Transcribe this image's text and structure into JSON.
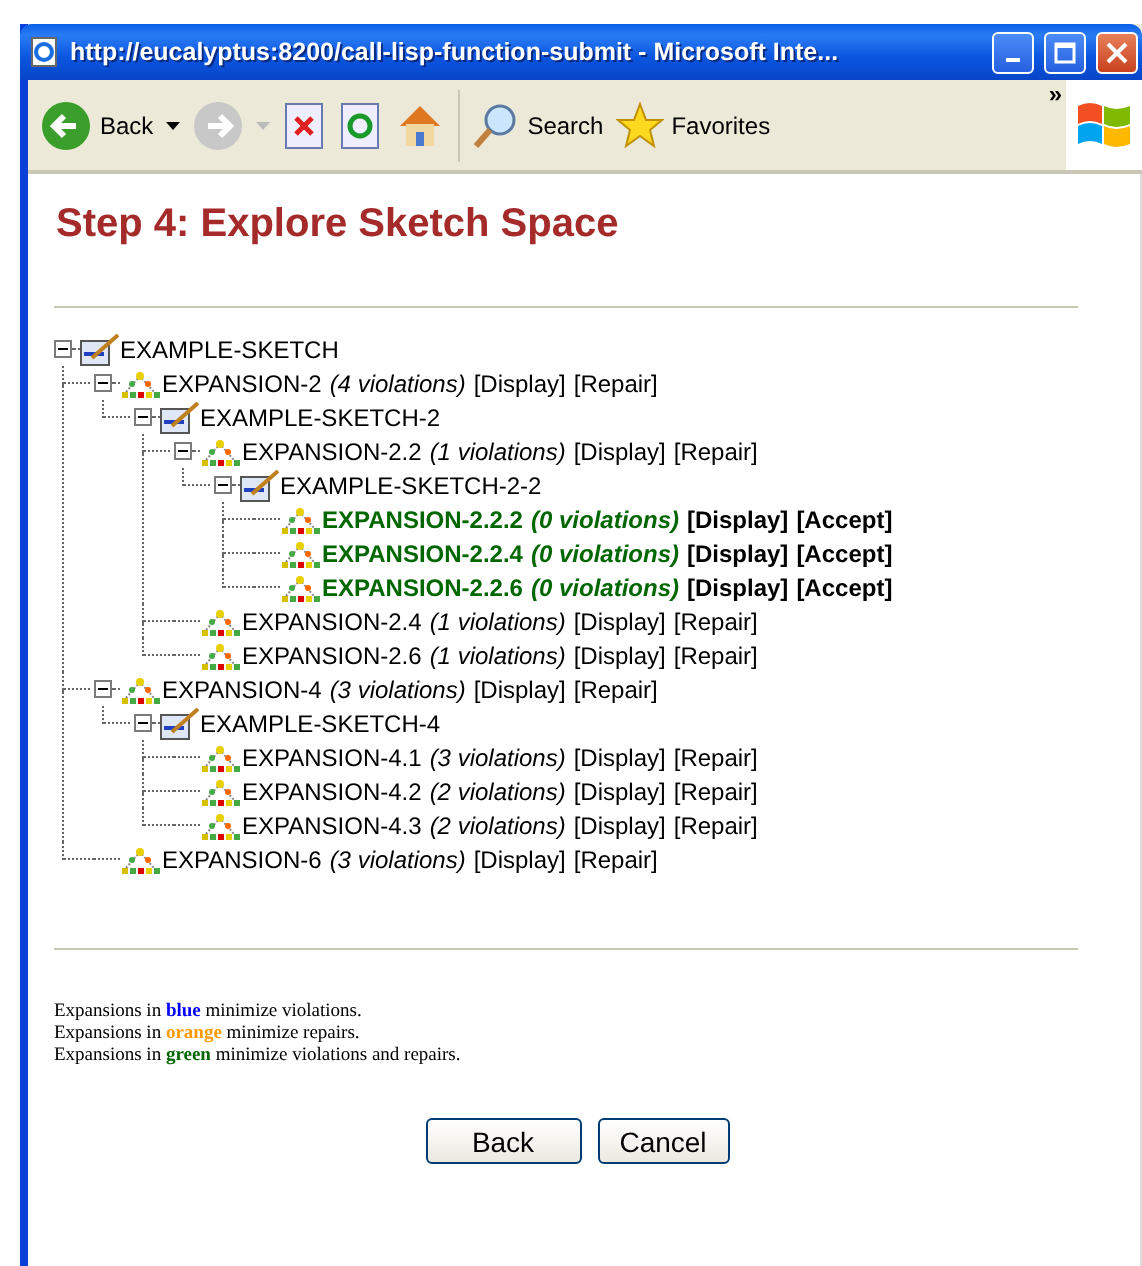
{
  "window": {
    "title": "http://eucalyptus:8200/call-lisp-function-submit - Microsoft Inte..."
  },
  "toolbar": {
    "back": "Back",
    "search": "Search",
    "favorites": "Favorites",
    "overflow": "»"
  },
  "heading": "Step 4: Explore Sketch Space",
  "tree": [
    {
      "kind": "sketch",
      "label": "EXAMPLE-SKETCH",
      "expanded": true,
      "children": [
        {
          "kind": "expansion",
          "label": "EXPANSION-2",
          "violations": "(4 violations)",
          "actions": [
            "[Display]",
            "[Repair]"
          ],
          "highlighted": false,
          "expanded": true,
          "children": [
            {
              "kind": "sketch",
              "label": "EXAMPLE-SKETCH-2",
              "expanded": true,
              "children": [
                {
                  "kind": "expansion",
                  "label": "EXPANSION-2.2",
                  "violations": "(1 violations)",
                  "actions": [
                    "[Display]",
                    "[Repair]"
                  ],
                  "highlighted": false,
                  "expanded": true,
                  "children": [
                    {
                      "kind": "sketch",
                      "label": "EXAMPLE-SKETCH-2-2",
                      "expanded": true,
                      "children": [
                        {
                          "kind": "expansion",
                          "label": "EXPANSION-2.2.2",
                          "violations": "(0 violations)",
                          "actions": [
                            "[Display]",
                            "[Accept]"
                          ],
                          "highlighted": true
                        },
                        {
                          "kind": "expansion",
                          "label": "EXPANSION-2.2.4",
                          "violations": "(0 violations)",
                          "actions": [
                            "[Display]",
                            "[Accept]"
                          ],
                          "highlighted": true
                        },
                        {
                          "kind": "expansion",
                          "label": "EXPANSION-2.2.6",
                          "violations": "(0 violations)",
                          "actions": [
                            "[Display]",
                            "[Accept]"
                          ],
                          "highlighted": true
                        }
                      ]
                    }
                  ]
                },
                {
                  "kind": "expansion",
                  "label": "EXPANSION-2.4",
                  "violations": "(1 violations)",
                  "actions": [
                    "[Display]",
                    "[Repair]"
                  ],
                  "highlighted": false
                },
                {
                  "kind": "expansion",
                  "label": "EXPANSION-2.6",
                  "violations": "(1 violations)",
                  "actions": [
                    "[Display]",
                    "[Repair]"
                  ],
                  "highlighted": false
                }
              ]
            }
          ]
        },
        {
          "kind": "expansion",
          "label": "EXPANSION-4",
          "violations": "(3 violations)",
          "actions": [
            "[Display]",
            "[Repair]"
          ],
          "highlighted": false,
          "expanded": true,
          "children": [
            {
              "kind": "sketch",
              "label": "EXAMPLE-SKETCH-4",
              "expanded": true,
              "children": [
                {
                  "kind": "expansion",
                  "label": "EXPANSION-4.1",
                  "violations": "(3 violations)",
                  "actions": [
                    "[Display]",
                    "[Repair]"
                  ],
                  "highlighted": false
                },
                {
                  "kind": "expansion",
                  "label": "EXPANSION-4.2",
                  "violations": "(2 violations)",
                  "actions": [
                    "[Display]",
                    "[Repair]"
                  ],
                  "highlighted": false
                },
                {
                  "kind": "expansion",
                  "label": "EXPANSION-4.3",
                  "violations": "(2 violations)",
                  "actions": [
                    "[Display]",
                    "[Repair]"
                  ],
                  "highlighted": false
                }
              ]
            }
          ]
        },
        {
          "kind": "expansion",
          "label": "EXPANSION-6",
          "violations": "(3 violations)",
          "actions": [
            "[Display]",
            "[Repair]"
          ],
          "highlighted": false
        }
      ]
    }
  ],
  "legend": [
    {
      "before": "Expansions in",
      "word": "blue",
      "after": "minimize violations.",
      "color": "#0000ff"
    },
    {
      "before": "Expansions in",
      "word": "orange",
      "after": "minimize repairs.",
      "color": "#ff9900"
    },
    {
      "before": "Expansions in",
      "word": "green",
      "after": "minimize violations and repairs.",
      "color": "#006600"
    }
  ],
  "buttons": [
    "Back",
    "Cancel"
  ]
}
